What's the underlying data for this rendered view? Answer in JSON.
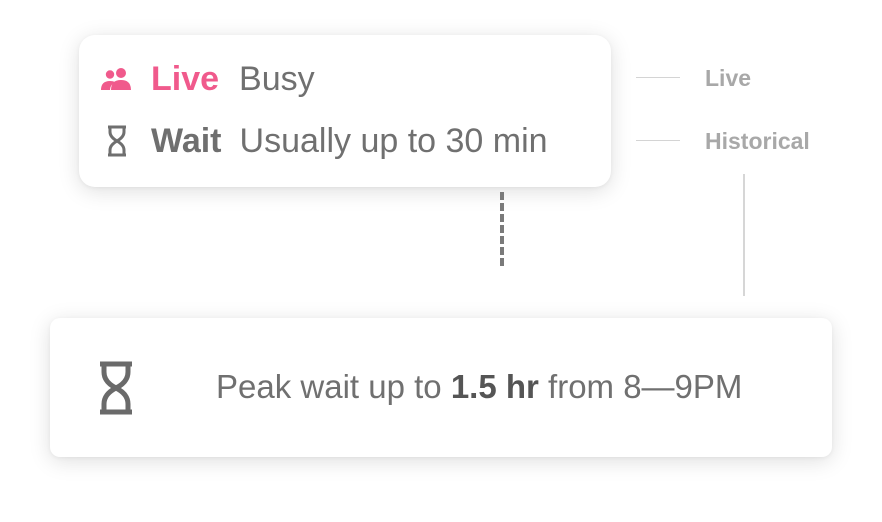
{
  "status_card": {
    "live_label": "Live",
    "live_value": "Busy",
    "wait_label": "Wait",
    "wait_value": "Usually up to 30 min"
  },
  "legend": {
    "live": "Live",
    "historical": "Historical"
  },
  "peak_card": {
    "prefix": "Peak wait up to",
    "duration": "1.5 hr",
    "suffix": "from 8—9PM"
  },
  "colors": {
    "accent": "#f05a8c",
    "text_gray": "#707070",
    "legend_gray": "#a8a8a8"
  },
  "icons": {
    "live": "people-icon",
    "wait": "hourglass-icon",
    "peak": "hourglass-icon"
  }
}
